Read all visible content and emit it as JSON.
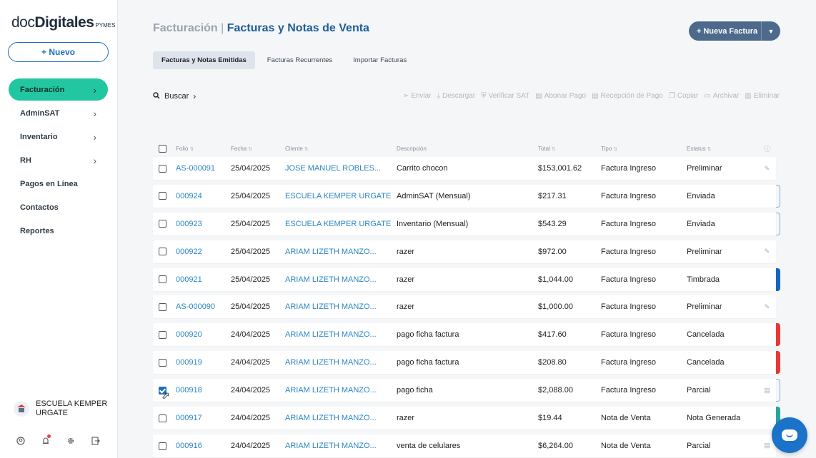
{
  "brand": {
    "part1": "doc",
    "part2": "Digitales",
    "part3": "PYMES"
  },
  "sidebar": {
    "new_button": "+ Nuevo",
    "items": [
      {
        "label": "Facturación",
        "chevron": true,
        "active": true
      },
      {
        "label": "AdminSAT",
        "chevron": true
      },
      {
        "label": "Inventario",
        "chevron": true
      },
      {
        "label": "RH",
        "chevron": true
      },
      {
        "label": "Pagos en Línea",
        "chevron": false
      },
      {
        "label": "Contactos",
        "chevron": false
      },
      {
        "label": "Reportes",
        "chevron": false
      }
    ],
    "company": "ESCUELA KEMPER URGATE"
  },
  "header": {
    "crumb": "Facturación",
    "separator": "|",
    "title": "Facturas y Notas de Venta",
    "new_invoice": "+ Nueva Factura"
  },
  "tabs": [
    {
      "label": "Facturas y Notas Emitidas",
      "active": true
    },
    {
      "label": "Facturas Recurrentes"
    },
    {
      "label": "Importar Facturas"
    }
  ],
  "toolbar": {
    "search": "Buscar",
    "actions": [
      {
        "label": "Enviar",
        "icon": "send-icon"
      },
      {
        "label": "Descargar",
        "icon": "download-icon"
      },
      {
        "label": "Verificar SAT",
        "icon": "shield-icon"
      },
      {
        "label": "Abonar Pago",
        "icon": "money-icon"
      },
      {
        "label": "Recepción de Pago",
        "icon": "receipt-icon"
      },
      {
        "label": "Copiar",
        "icon": "copy-icon"
      },
      {
        "label": "Archivar",
        "icon": "folder-icon"
      },
      {
        "label": "Eliminar",
        "icon": "trash-icon"
      }
    ]
  },
  "table": {
    "headers": {
      "folio": "Folio",
      "fecha": "Fecha",
      "cliente": "Cliente",
      "descripcion": "Descripción",
      "total": "Total",
      "tipo": "Tipo",
      "estatus": "Estatus"
    },
    "rows": [
      {
        "folio": "AS-000091",
        "fecha": "25/04/2025",
        "cliente": "JOSE MANUEL ROBLES...",
        "descripcion": "Carrito chocon",
        "total": "$153,001.62",
        "tipo": "Factura Ingreso",
        "estatus": "Preliminar",
        "action": "edit-icon",
        "mark": ""
      },
      {
        "folio": "000924",
        "fecha": "25/04/2025",
        "cliente": "ESCUELA KEMPER URGATE",
        "descripcion": "AdminSAT (Mensual)",
        "total": "$217.31",
        "tipo": "Factura Ingreso",
        "estatus": "Enviada",
        "action": "",
        "mark": "outline"
      },
      {
        "folio": "000923",
        "fecha": "25/04/2025",
        "cliente": "ESCUELA KEMPER URGATE",
        "descripcion": "Inventario (Mensual)",
        "total": "$543.29",
        "tipo": "Factura Ingreso",
        "estatus": "Enviada",
        "action": "",
        "mark": "outline"
      },
      {
        "folio": "000922",
        "fecha": "25/04/2025",
        "cliente": "ARIAM LIZETH MANZO...",
        "descripcion": "razer",
        "total": "$972.00",
        "tipo": "Factura Ingreso",
        "estatus": "Preliminar",
        "action": "edit-icon",
        "mark": ""
      },
      {
        "folio": "000921",
        "fecha": "25/04/2025",
        "cliente": "ARIAM LIZETH MANZO...",
        "descripcion": "razer",
        "total": "$1,044.00",
        "tipo": "Factura Ingreso",
        "estatus": "Timbrada",
        "action": "",
        "mark": "#1565c0"
      },
      {
        "folio": "AS-000090",
        "fecha": "25/04/2025",
        "cliente": "ARIAM LIZETH MANZO...",
        "descripcion": "razer",
        "total": "$1,000.00",
        "tipo": "Factura Ingreso",
        "estatus": "Preliminar",
        "action": "edit-icon",
        "mark": ""
      },
      {
        "folio": "000920",
        "fecha": "24/04/2025",
        "cliente": "ARIAM LIZETH MANZO...",
        "descripcion": "pago ficha factura",
        "total": "$417.60",
        "tipo": "Factura Ingreso",
        "estatus": "Cancelada",
        "action": "",
        "mark": "#e53935"
      },
      {
        "folio": "000919",
        "fecha": "24/04/2025",
        "cliente": "ARIAM LIZETH MANZO...",
        "descripcion": "pago ficha factura",
        "total": "$208.80",
        "tipo": "Factura Ingreso",
        "estatus": "Cancelada",
        "action": "",
        "mark": "#e53935"
      },
      {
        "folio": "000918",
        "fecha": "24/04/2025",
        "cliente": "ARIAM LIZETH MANZO...",
        "descripcion": "pago ficha",
        "total": "$2,088.00",
        "tipo": "Factura Ingreso",
        "estatus": "Parcial",
        "action": "money-icon",
        "mark": "outline",
        "checked": true
      },
      {
        "folio": "000917",
        "fecha": "24/04/2025",
        "cliente": "ARIAM LIZETH MANZO...",
        "descripcion": "razer",
        "total": "$19.44",
        "tipo": "Nota de Venta",
        "estatus": "Nota Generada",
        "action": "",
        "mark": "#26a69a"
      },
      {
        "folio": "000916",
        "fecha": "24/04/2025",
        "cliente": "ARIAM LIZETH MANZO...",
        "descripcion": "venta de celulares",
        "total": "$6,264.00",
        "tipo": "Nota de Venta",
        "estatus": "Parcial",
        "action": "money-icon",
        "mark": ""
      }
    ]
  },
  "colors": {
    "accent": "#22c7a2",
    "primary": "#1f5d96",
    "link": "#2b86c4",
    "cancel": "#e53935"
  }
}
